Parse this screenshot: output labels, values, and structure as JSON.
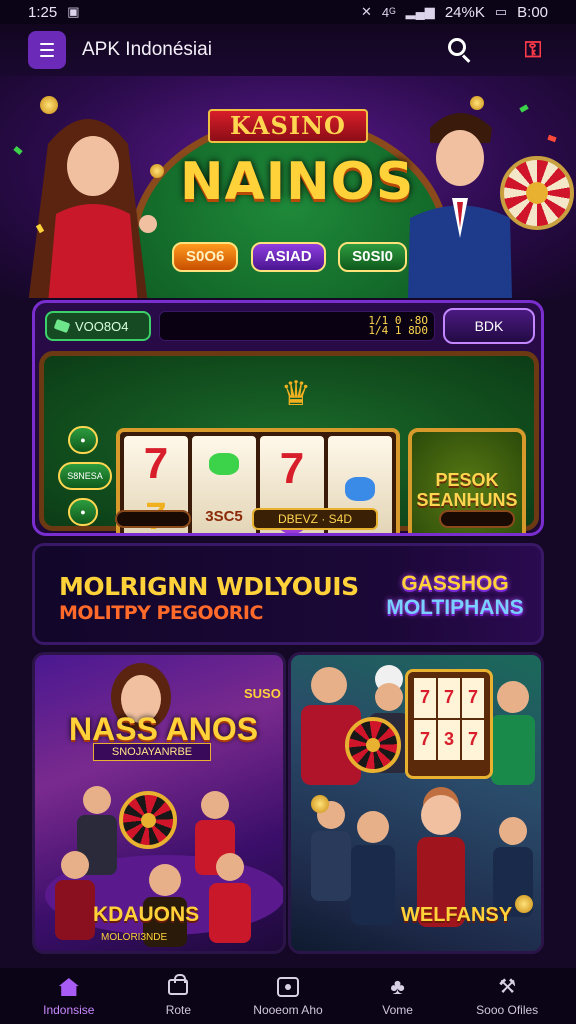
{
  "status_bar": {
    "time": "1:25",
    "signal_text": "4ᴳ",
    "battery_text": "24%K",
    "clock_right": "B:00"
  },
  "app_bar": {
    "title": "APK Indonésiai"
  },
  "hero": {
    "kicker": "KASINO",
    "title": "NAINOS",
    "chips": [
      "S0O6",
      "ASIAD",
      "S0SI0"
    ]
  },
  "slot_panel": {
    "balance_label": "VOO8O4",
    "counter": "1/1 0 ·8O\n1/4 1 8D0",
    "bet_button": "BDK",
    "crown_label": "∀W",
    "side_buttons": [
      "",
      "S8NESA",
      "",
      ""
    ],
    "reel_small": "3SC5",
    "bonus_text": "PESOK SEANHUNS",
    "spin_label": "DBEVZ · S4D"
  },
  "promo": {
    "title": "MOLRIGNN WDLYOUIS",
    "subtitle": "MOLITPY PEGOORIC",
    "badge_line1": "GASSHOG",
    "badge_line2": "MOLTIPHANS"
  },
  "cards": [
    {
      "title": "NASS ANOS",
      "tag": "SNOJAYANRBE",
      "footer": "KDAUONS",
      "footer_sub": "MOLORI3NDE"
    },
    {
      "floating_label": "SUSO",
      "footer": "WELFANSY"
    }
  ],
  "bottom_nav": [
    {
      "label": "Indonsise",
      "icon": "home-icon",
      "active": true
    },
    {
      "label": "Rote",
      "icon": "bag-icon",
      "active": false
    },
    {
      "label": "Nooeom Aho",
      "icon": "video-icon",
      "active": false
    },
    {
      "label": "Vome",
      "icon": "spade-icon",
      "active": false
    },
    {
      "label": "Sooo Ofiles",
      "icon": "tools-icon",
      "active": false
    }
  ],
  "colors": {
    "accent": "#a85cf5",
    "gold": "#ffd23a",
    "background": "#150726"
  }
}
